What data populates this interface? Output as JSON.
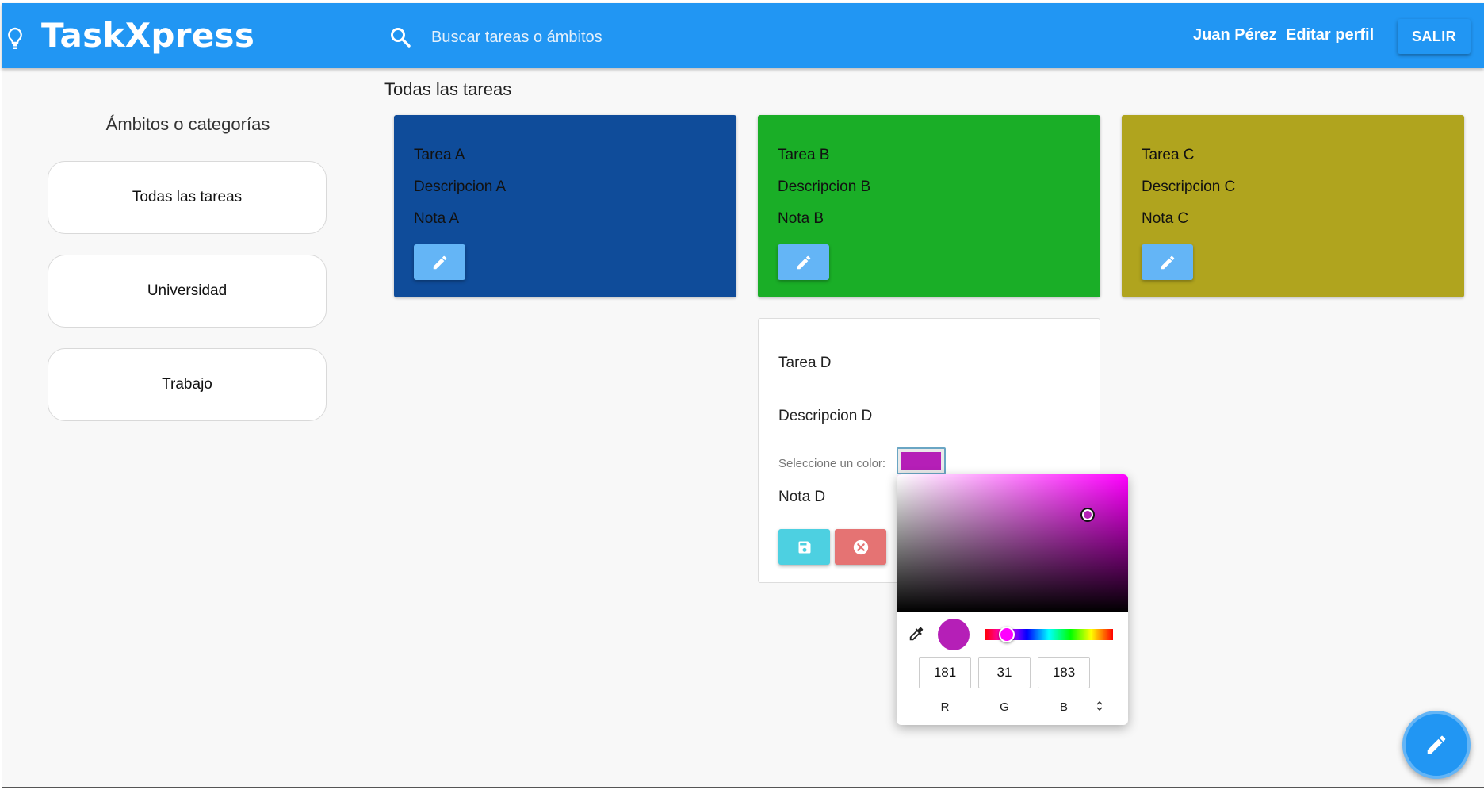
{
  "header": {
    "brand": "TaskXpress",
    "search_placeholder": "Buscar tareas o ámbitos",
    "user_name": "Juan Pérez",
    "edit_profile": "Editar perfil",
    "logout": "SALIR",
    "color": "#2196f3"
  },
  "sidebar": {
    "title": "Ámbitos o categorías",
    "items": [
      {
        "label": "Todas las tareas"
      },
      {
        "label": "Universidad"
      },
      {
        "label": "Trabajo"
      }
    ]
  },
  "main": {
    "section_title": "Todas las tareas",
    "tasks": [
      {
        "title": "Tarea A",
        "description": "Descripcion A",
        "note": "Nota A",
        "color": "#0f4c9a",
        "icon": "pencil-icon"
      },
      {
        "title": "Tarea B",
        "description": "Descripcion B",
        "note": "Nota B",
        "color": "#1aae27",
        "icon": "pencil-icon"
      },
      {
        "title": "Tarea C",
        "description": "Descripcion C",
        "note": "Nota C",
        "color": "#b0a41e",
        "icon": "pencil-icon"
      }
    ],
    "edit_form": {
      "title": "Tarea D",
      "description": "Descripcion D",
      "color_label": "Seleccione un color:",
      "note": "Nota D",
      "selected_color": "#b51fb7",
      "save_icon": "save-icon",
      "cancel_icon": "cancel-icon"
    }
  },
  "color_picker": {
    "r": "181",
    "g": "31",
    "b": "183",
    "r_label": "R",
    "g_label": "G",
    "b_label": "B",
    "hue_color": "#ff00ff"
  },
  "fab": {
    "icon": "pencil-icon"
  }
}
